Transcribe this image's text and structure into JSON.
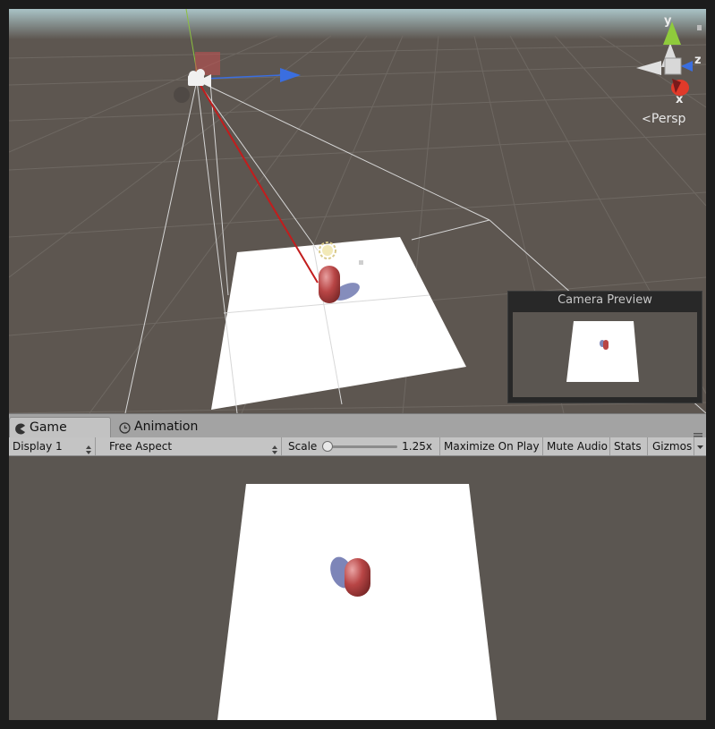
{
  "scene": {
    "projection_label": "Persp",
    "axis_labels": {
      "y": "y",
      "z": "z",
      "x": "x"
    },
    "camera_preview": {
      "title": "Camera Preview"
    }
  },
  "tabs": [
    {
      "label": "Game",
      "icon": "game-pacman-icon",
      "active": true
    },
    {
      "label": "Animation",
      "icon": "clock-icon",
      "active": false
    }
  ],
  "toolbar": {
    "display": "Display 1",
    "aspect": "Free Aspect",
    "scale_label": "Scale",
    "scale_value": "1.25x",
    "maximize_on_play": "Maximize On Play",
    "mute_audio": "Mute Audio",
    "stats": "Stats",
    "gizmos": "Gizmos"
  },
  "colors": {
    "background": "#5b5651",
    "plane": "#ffffff",
    "capsule": "#b84545",
    "x_axis": "#e23a2a",
    "y_axis": "#7ec23c",
    "z_axis": "#3a6ee0"
  }
}
